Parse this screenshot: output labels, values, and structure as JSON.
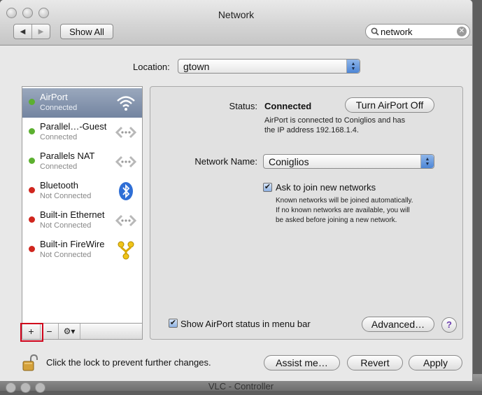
{
  "window": {
    "title": "Network"
  },
  "toolbar": {
    "back_label": "◀",
    "forward_label": "▶",
    "show_all_label": "Show All"
  },
  "search": {
    "value": "network",
    "clear_label": "✕"
  },
  "location": {
    "label": "Location:",
    "value": "gtown"
  },
  "services": [
    {
      "name": "AirPort",
      "status": "Connected",
      "dot_color": "#5cb030",
      "icon": "wifi-icon",
      "selected": true
    },
    {
      "name": "Parallel…-Guest",
      "status": "Connected",
      "dot_color": "#5cb030",
      "icon": "ethernet-icon"
    },
    {
      "name": "Parallels NAT",
      "status": "Connected",
      "dot_color": "#5cb030",
      "icon": "ethernet-icon"
    },
    {
      "name": "Bluetooth",
      "status": "Not Connected",
      "dot_color": "#d0261e",
      "icon": "bluetooth-icon"
    },
    {
      "name": "Built-in Ethernet",
      "status": "Not Connected",
      "dot_color": "#d0261e",
      "icon": "ethernet-icon"
    },
    {
      "name": "Built-in FireWire",
      "status": "Not Connected",
      "dot_color": "#d0261e",
      "icon": "firewire-icon"
    }
  ],
  "list_toolbar": {
    "add_label": "+",
    "remove_label": "−",
    "gear_label": "⚙▾"
  },
  "detail": {
    "status_label": "Status:",
    "status_value": "Connected",
    "turn_off_label": "Turn AirPort Off",
    "status_desc_line1": "AirPort is connected to Coniglios and has",
    "status_desc_line2": "the IP address 192.168.1.4.",
    "network_name_label": "Network Name:",
    "network_name_value": "Coniglios",
    "ask_join_label": "Ask to join new networks",
    "ask_join_checked": true,
    "ask_desc_line1": "Known networks will be joined automatically.",
    "ask_desc_line2": "If no known networks are available, you will",
    "ask_desc_line3": "be asked before joining a new network.",
    "show_status_label": "Show AirPort status in menu bar",
    "show_status_checked": true,
    "advanced_label": "Advanced…",
    "help_label": "?"
  },
  "footer": {
    "lock_text": "Click the lock to prevent further changes.",
    "assist_label": "Assist me…",
    "revert_label": "Revert",
    "apply_label": "Apply"
  },
  "background_window": {
    "title": "VLC - Controller"
  },
  "colors": {
    "selection": "#8494ae",
    "connected": "#5cb030",
    "disconnected": "#d0261e",
    "highlight_box": "#d0021b"
  }
}
